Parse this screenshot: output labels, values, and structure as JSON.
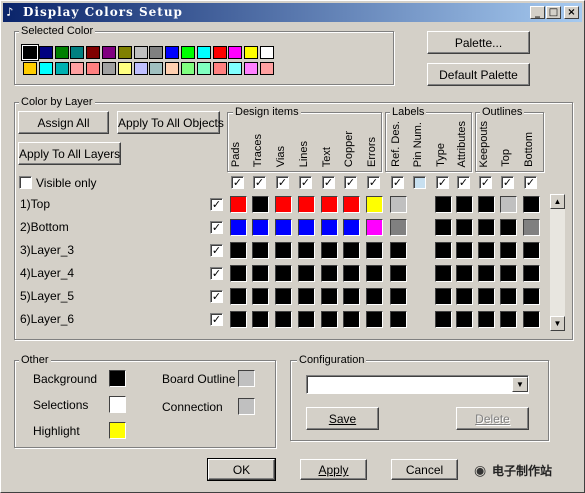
{
  "window": {
    "title": "Display Colors Setup",
    "min_label": "_",
    "max_label": "□",
    "close_label": "×"
  },
  "selected_color": {
    "label": "Selected Color",
    "row1": [
      "#000000",
      "#000080",
      "#008000",
      "#008080",
      "#800000",
      "#800080",
      "#808000",
      "#c0c0c0",
      "#808080",
      "#0000ff",
      "#00ff00",
      "#00ffff",
      "#ff0000",
      "#ff00ff",
      "#ffff00",
      "#ffffff"
    ],
    "row2": [
      "#ffcc00",
      "#00ffff",
      "#00b0b0",
      "#ffa0a0",
      "#ff8080",
      "#a0a0a0",
      "#ffff80",
      "#c0c0ff",
      "#a0c0c0",
      "#ffd0b0",
      "#80ff80",
      "#80ffc0",
      "#ff8080",
      "#80ffff",
      "#ff80ff",
      "#ffa0a0"
    ]
  },
  "buttons": {
    "palette": "Palette...",
    "default_palette": "Default Palette",
    "assign_all": "Assign All",
    "apply_all_objects": "Apply To All Objects",
    "apply_all_layers": "Apply To All Layers",
    "save": "Save",
    "delete": "Delete",
    "ok": "OK",
    "apply": "Apply",
    "cancel": "Cancel"
  },
  "color_by_layer": {
    "label": "Color by Layer",
    "visible_only": "Visible only",
    "groups": {
      "design": "Design items",
      "labels": "Labels",
      "outlines": "Outlines"
    },
    "columns": [
      "Pads",
      "Traces",
      "Vias",
      "Lines",
      "Text",
      "Copper",
      "Errors",
      "Ref. Des.",
      "Pin Num.",
      "Type",
      "Attributes",
      "Keepouts",
      "Top",
      "Bottom"
    ],
    "column_checked": [
      true,
      true,
      true,
      true,
      true,
      true,
      true,
      true,
      false,
      true,
      true,
      true,
      true,
      true
    ],
    "layers": [
      {
        "name": "1)Top",
        "checked": true,
        "colors": [
          "#ff0000",
          "#000000",
          "#ff0000",
          "#ff0000",
          "#ff0000",
          "#ff0000",
          "#ffff00",
          "#c0c0c0",
          "",
          "#000000",
          "#000000",
          "#000000",
          "#c0c0c0",
          "#000000"
        ]
      },
      {
        "name": "2)Bottom",
        "checked": true,
        "colors": [
          "#0000ff",
          "#0000ff",
          "#0000ff",
          "#0000ff",
          "#0000ff",
          "#0000ff",
          "#ff00ff",
          "#808080",
          "",
          "#000000",
          "#000000",
          "#000000",
          "#000000",
          "#808080"
        ]
      },
      {
        "name": "3)Layer_3",
        "checked": true,
        "colors": [
          "#000000",
          "#000000",
          "#000000",
          "#000000",
          "#000000",
          "#000000",
          "#000000",
          "#000000",
          "",
          "#000000",
          "#000000",
          "#000000",
          "#000000",
          "#000000"
        ]
      },
      {
        "name": "4)Layer_4",
        "checked": true,
        "colors": [
          "#000000",
          "#000000",
          "#000000",
          "#000000",
          "#000000",
          "#000000",
          "#000000",
          "#000000",
          "",
          "#000000",
          "#000000",
          "#000000",
          "#000000",
          "#000000"
        ]
      },
      {
        "name": "5)Layer_5",
        "checked": true,
        "colors": [
          "#000000",
          "#000000",
          "#000000",
          "#000000",
          "#000000",
          "#000000",
          "#000000",
          "#000000",
          "",
          "#000000",
          "#000000",
          "#000000",
          "#000000",
          "#000000"
        ]
      },
      {
        "name": "6)Layer_6",
        "checked": true,
        "colors": [
          "#000000",
          "#000000",
          "#000000",
          "#000000",
          "#000000",
          "#000000",
          "#000000",
          "#000000",
          "",
          "#000000",
          "#000000",
          "#000000",
          "#000000",
          "#000000"
        ]
      }
    ]
  },
  "other": {
    "label": "Other",
    "items": [
      {
        "label": "Background",
        "color": "#000000"
      },
      {
        "label": "Selections",
        "color": "#ffffff"
      },
      {
        "label": "Highlight",
        "color": "#ffff00"
      },
      {
        "label": "Board Outline",
        "color": "#c0c0c0"
      },
      {
        "label": "Connection",
        "color": "#c0c0c0"
      }
    ]
  },
  "configuration": {
    "label": "Configuration",
    "value": ""
  },
  "watermark": {
    "text": "电子制作站"
  }
}
